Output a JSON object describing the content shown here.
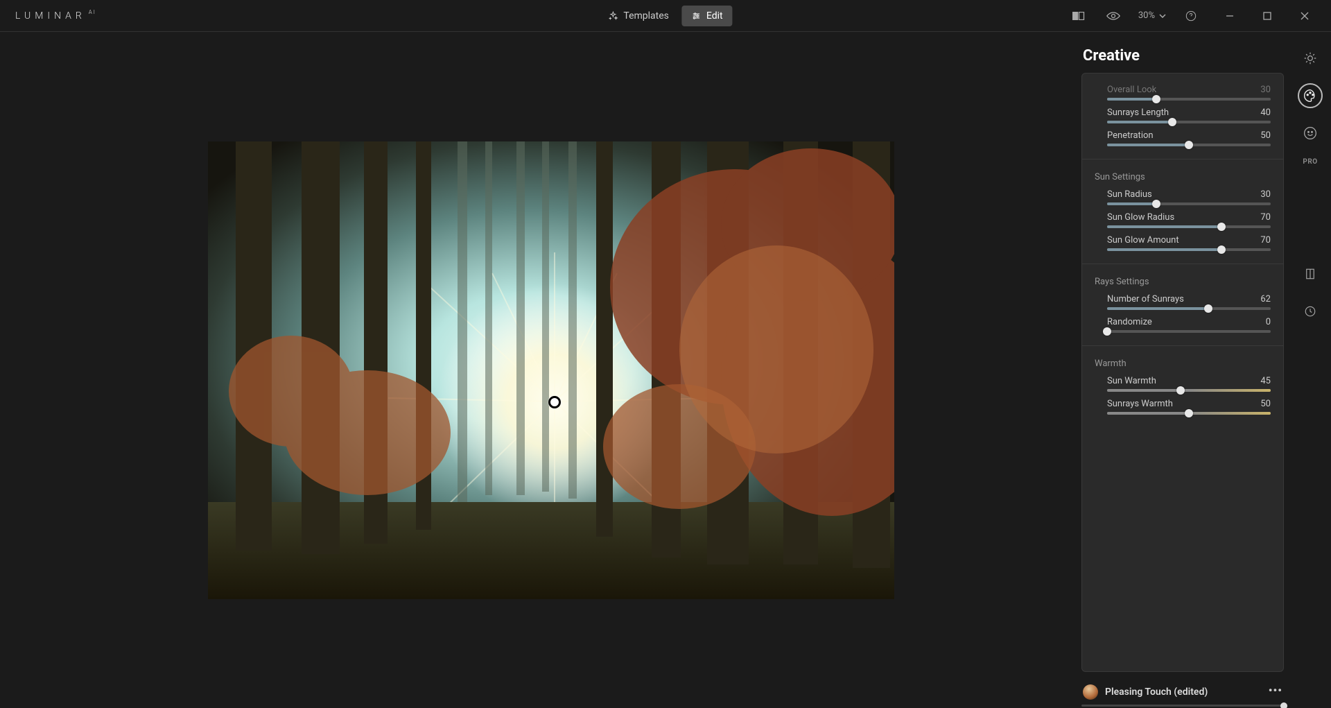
{
  "app": {
    "logo_main": "LUMINAR",
    "logo_sup": "AI"
  },
  "topnav": {
    "templates_label": "Templates",
    "edit_label": "Edit",
    "zoom_label": "30%"
  },
  "panel": {
    "title": "Creative",
    "overall": {
      "label": "Overall Look",
      "sunrays_length": {
        "label": "Sunrays Length",
        "value": 40
      },
      "overall_look": {
        "label": "Overall Look",
        "value": 30
      },
      "penetration": {
        "label": "Penetration",
        "value": 50
      }
    },
    "sun_settings": {
      "title": "Sun Settings",
      "sun_radius": {
        "label": "Sun Radius",
        "value": 30
      },
      "sun_glow_radius": {
        "label": "Sun Glow Radius",
        "value": 70
      },
      "sun_glow_amount": {
        "label": "Sun Glow Amount",
        "value": 70
      }
    },
    "rays_settings": {
      "title": "Rays Settings",
      "number_of_sunrays": {
        "label": "Number of Sunrays",
        "value": 62
      },
      "randomize": {
        "label": "Randomize",
        "value": 0
      }
    },
    "warmth": {
      "title": "Warmth",
      "sun_warmth": {
        "label": "Sun Warmth",
        "value": 45
      },
      "sunrays_warmth": {
        "label": "Sunrays Warmth",
        "value": 50
      }
    }
  },
  "template_strip": {
    "name": "Pleasing Touch (edited)"
  },
  "toolrail": {
    "pro_label": "PRO"
  }
}
